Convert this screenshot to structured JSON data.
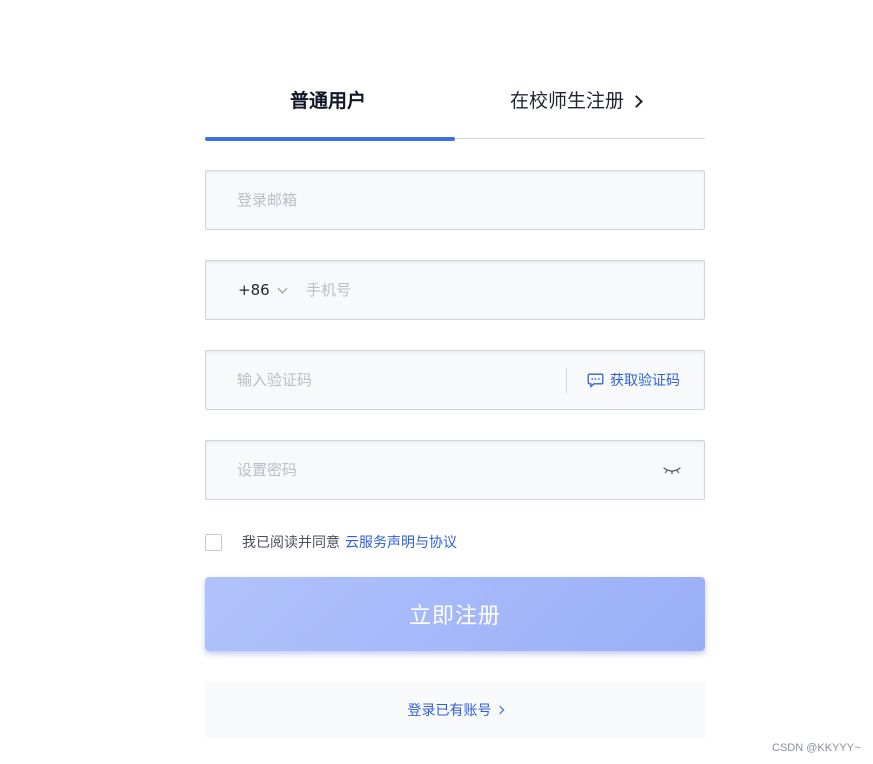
{
  "tabs": {
    "regular": "普通用户",
    "campus": "在校师生注册"
  },
  "form": {
    "email_placeholder": "登录邮箱",
    "country_code": "+86",
    "phone_placeholder": "手机号",
    "code_placeholder": "输入验证码",
    "get_code_label": "获取验证码",
    "password_placeholder": "设置密码",
    "agree_text": "我已阅读并同意",
    "agree_link": "云服务声明与协议",
    "submit_label": "立即注册",
    "login_link": "登录已有账号"
  },
  "watermark": "CSDN @KKYYY~",
  "colors": {
    "accent": "#3d6fe8",
    "link": "#2f5fd8",
    "submit_start": "#b0c3fb",
    "submit_end": "#9aaef7"
  }
}
